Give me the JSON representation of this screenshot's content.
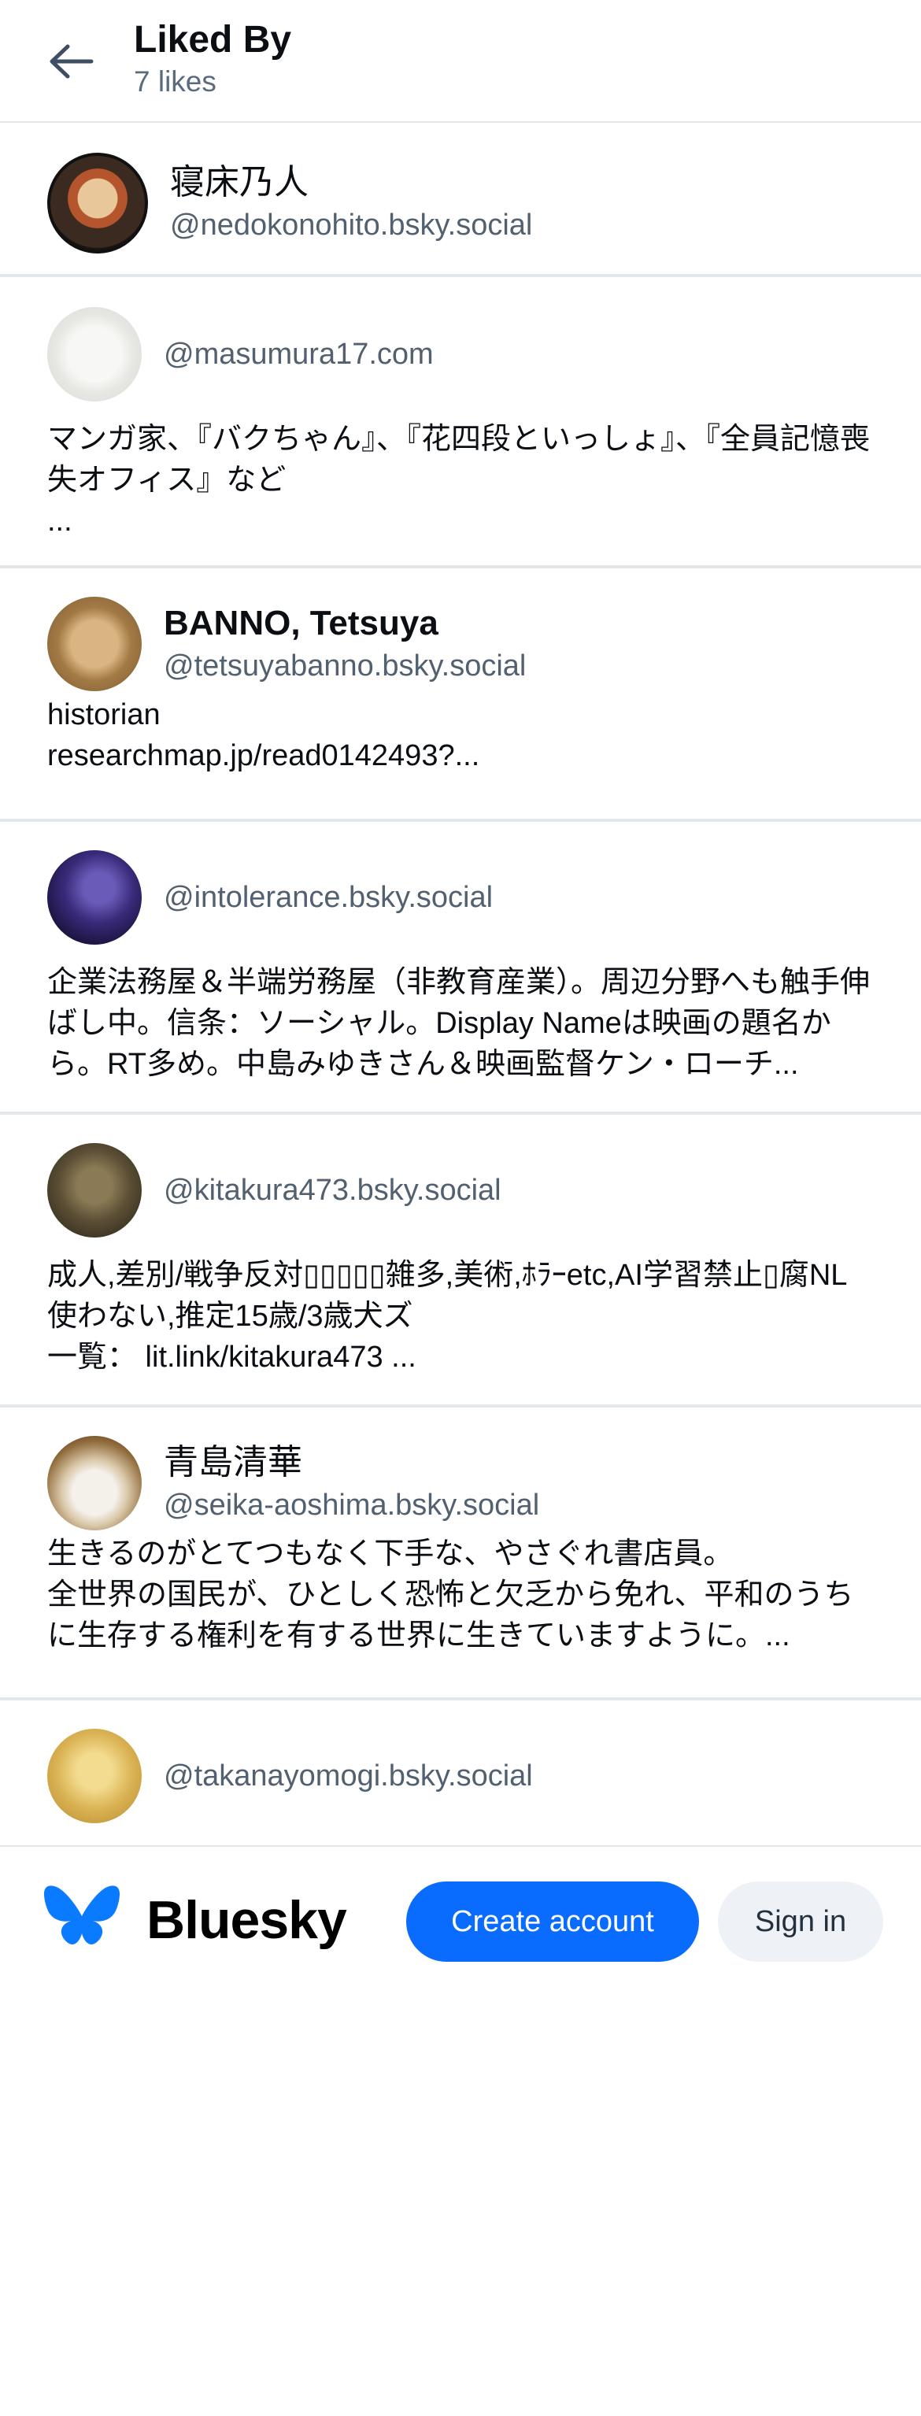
{
  "header": {
    "back_icon": "arrow-left-icon",
    "title": "Liked By",
    "subtitle": "7 likes"
  },
  "likers": [
    {
      "display_name": "寝床乃人",
      "handle": "@nedokonohito.bsky.social",
      "bio": ""
    },
    {
      "display_name": "",
      "handle": "@masumura17.com",
      "bio": "マンガ家、『バクちゃん』、『花四段といっしょ』、『全員記憶喪失オフィス』など\n..."
    },
    {
      "display_name": "BANNO, Tetsuya",
      "handle": "@tetsuyabanno.bsky.social",
      "bio": "historian\nresearchmap.jp/read0142493?..."
    },
    {
      "display_name": "",
      "handle": "@intolerance.bsky.social",
      "bio": "企業法務屋＆半端労務屋（非教育産業）。周辺分野へも触手伸ばし中。信条：ソーシャル。Display Nameは映画の題名から。RT多め。中島みゆきさん＆映画監督ケン・ローチ..."
    },
    {
      "display_name": "",
      "handle": "@kitakura473.bsky.social",
      "bio": "成人,差別/戦争反対▯▯▯▯▯雑多,美術,ﾎﾗｰetc,AI学習禁止▯腐NL使わない,推定15歳/3歳犬ズ\n一覧： lit.link/kitakura473 ..."
    },
    {
      "display_name": "青島清華",
      "handle": "@seika-aoshima.bsky.social",
      "bio": "生きるのがとてつもなく下手な、やさぐれ書店員。\n全世界の国民が、ひとしく恐怖と欠乏から免れ、平和のうちに生存する権利を有する世界に生きていますように。..."
    },
    {
      "display_name": "",
      "handle": "@takanayomogi.bsky.social",
      "bio": ""
    }
  ],
  "footer": {
    "logo_icon": "butterfly-logo-icon",
    "brand": "Bluesky",
    "create_account_label": "Create account",
    "sign_in_label": "Sign in"
  },
  "colors": {
    "accent": "#0a6cff",
    "divider": "#e2e7ec",
    "handle": "#52606f"
  }
}
